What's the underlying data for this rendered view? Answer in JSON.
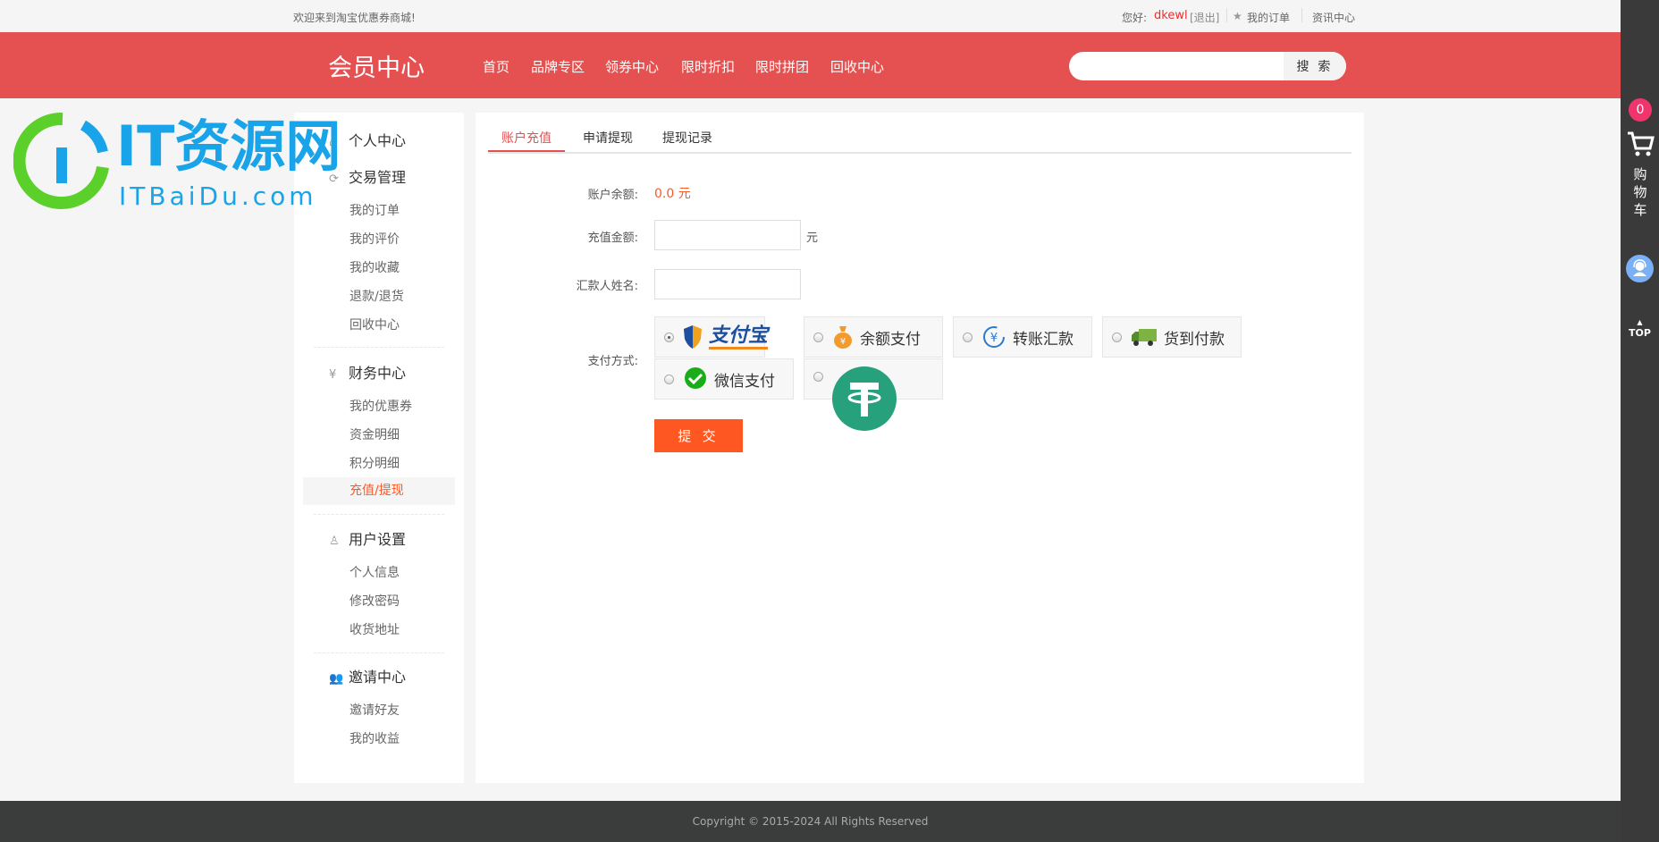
{
  "topbar": {
    "welcome": "欢迎来到淘宝优惠券商城!",
    "greeting": "您好:",
    "username": "dkewl",
    "logout": "[退出]",
    "my_orders": "我的订单",
    "news": "资讯中心"
  },
  "header": {
    "title": "会员中心",
    "nav": [
      "首页",
      "品牌专区",
      "领券中心",
      "限时折扣",
      "限时拼团",
      "回收中心"
    ],
    "search_placeholder": "",
    "search_button": "搜 索"
  },
  "sidebar": {
    "groups": [
      {
        "title": "个人中心",
        "icon": "home-icon",
        "items": []
      },
      {
        "title": "交易管理",
        "icon": "transaction-icon",
        "items": [
          "我的订单",
          "我的评价",
          "我的收藏",
          "退款/退货",
          "回收中心"
        ]
      },
      {
        "title": "财务中心",
        "icon": "finance-icon",
        "items": [
          "我的优惠券",
          "资金明细",
          "积分明细",
          "充值/提现"
        ]
      },
      {
        "title": "用户设置",
        "icon": "user-settings-icon",
        "items": [
          "个人信息",
          "修改密码",
          "收货地址"
        ]
      },
      {
        "title": "邀请中心",
        "icon": "invite-icon",
        "items": [
          "邀请好友",
          "我的收益"
        ]
      }
    ],
    "active_item": "充值/提现"
  },
  "main": {
    "tabs": [
      "账户充值",
      "申请提现",
      "提现记录"
    ],
    "active_tab": "账户充值",
    "form": {
      "balance_label": "账户余额:",
      "balance_value": "0.0 元",
      "amount_label": "充值金额:",
      "amount_value": "",
      "amount_unit": "元",
      "payer_label": "汇款人姓名:",
      "payer_value": "",
      "payment_label": "支付方式:",
      "payment_methods": [
        {
          "label": "支付宝",
          "icon": "alipay-icon",
          "selected": true
        },
        {
          "label": "余额支付",
          "icon": "money-bag-icon",
          "selected": false
        },
        {
          "label": "转账汇款",
          "icon": "transfer-icon",
          "selected": false
        },
        {
          "label": "货到付款",
          "icon": "truck-icon",
          "selected": false
        },
        {
          "label": "微信支付",
          "icon": "wechat-icon",
          "selected": false
        },
        {
          "label": "",
          "icon": "tether-icon",
          "selected": false
        }
      ],
      "submit": "提 交"
    }
  },
  "rightbar": {
    "cart_count": "0",
    "cart_label": "购物车",
    "top_label": "TOP"
  },
  "footer": {
    "copyright": "Copyright © 2015-2024 All Rights Reserved"
  },
  "watermark": {
    "title": "IT资源网",
    "subtitle": "ITBaiDu.com"
  },
  "colors": {
    "brand": "#e55151",
    "accent": "#ff5722",
    "footer": "#3b3c3c",
    "sidebar_right": "#3a3a3a"
  }
}
